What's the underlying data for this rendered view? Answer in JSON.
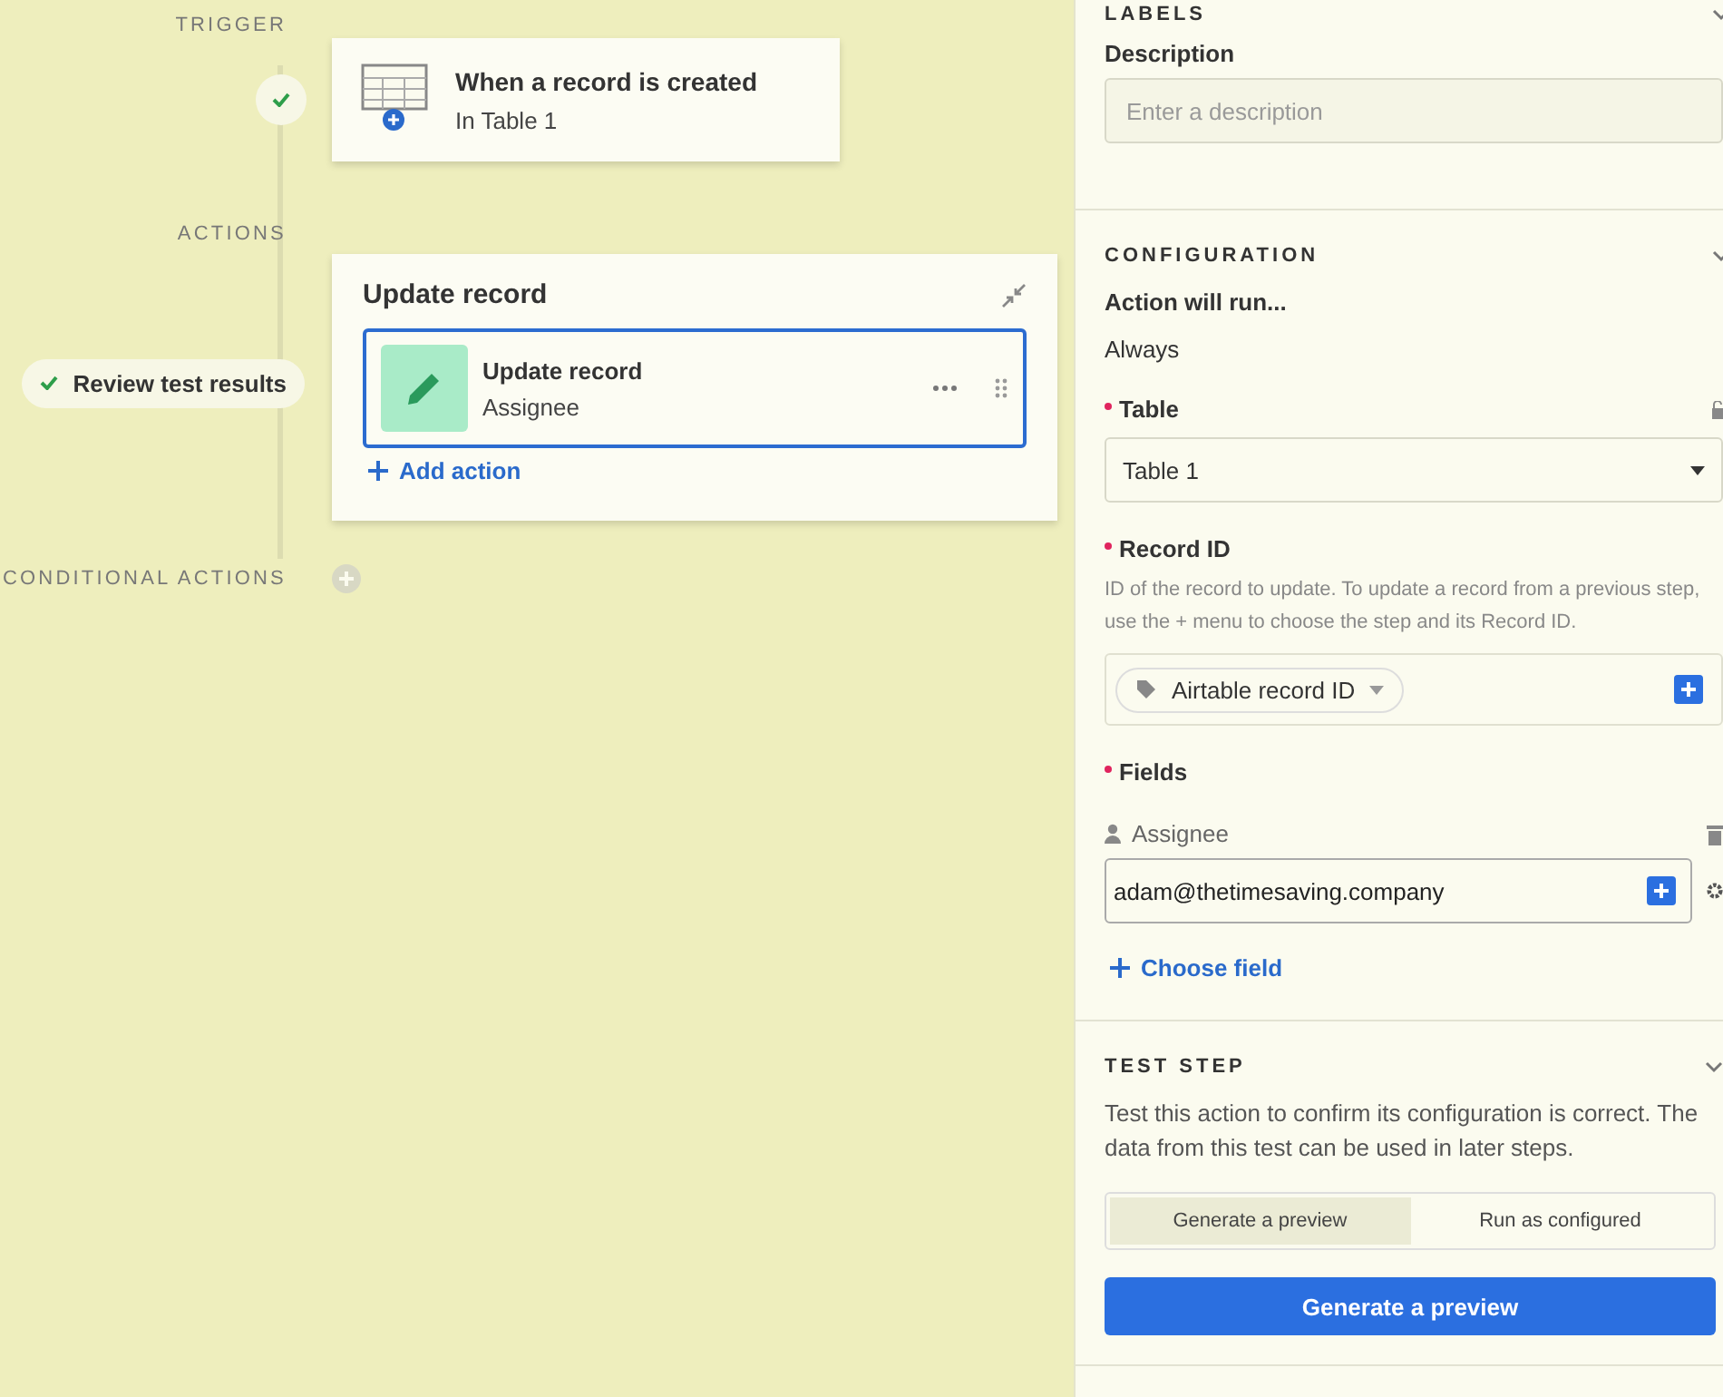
{
  "canvas": {
    "trigger_label": "TRIGGER",
    "trigger": {
      "tested": true,
      "title": "When a record is created",
      "subtitle": "In Table 1"
    },
    "actions_label": "ACTIONS",
    "review_button": "Review test results",
    "action_group": {
      "title": "Update record",
      "steps": [
        {
          "title": "Update record",
          "subtitle": "Assignee",
          "selected": true
        }
      ],
      "add_action": "Add action"
    },
    "conditional_label": "CONDITIONAL ACTIONS"
  },
  "panel": {
    "labels": {
      "heading": "LABELS",
      "description_label": "Description",
      "description_placeholder": "Enter a description"
    },
    "configuration": {
      "heading": "CONFIGURATION",
      "run_label": "Action will run...",
      "run_value": "Always",
      "table": {
        "label": "Table",
        "required": true,
        "value": "Table 1"
      },
      "record_id": {
        "label": "Record ID",
        "required": true,
        "help": "ID of the record to update. To update a record from a previous step, use the + menu to choose the step and its Record ID.",
        "token": "Airtable record ID"
      },
      "fields": {
        "label": "Fields",
        "required": true,
        "items": [
          {
            "name": "Assignee",
            "value": "adam@thetimesaving.company"
          }
        ],
        "choose_field": "Choose field"
      }
    },
    "test_step": {
      "heading": "TEST STEP",
      "description": "Test this action to confirm its configuration is correct. The data from this test can be used in later steps.",
      "modes": [
        {
          "label": "Generate a preview",
          "selected": true
        },
        {
          "label": "Run as configured",
          "selected": false
        }
      ],
      "button": "Generate a preview"
    }
  }
}
